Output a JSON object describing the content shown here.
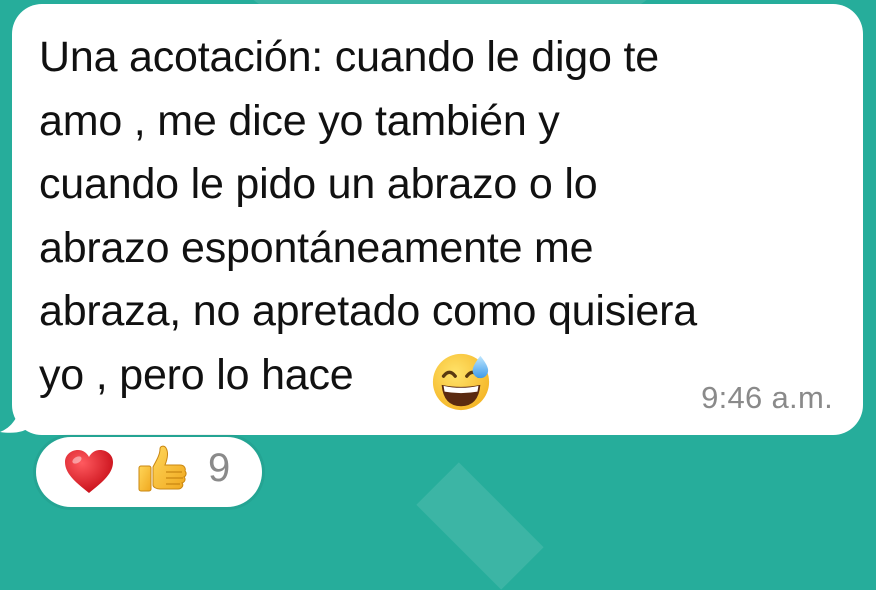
{
  "message": {
    "text_before_emoji": "Una acotación: cuando le digo te\namo , me dice yo también y\ncuando le pido un abrazo o lo\nabrazo espontáneamente me\nabraza, no apretado como quisiera\nyo , pero lo hace",
    "emoji": "sweat-smile-emoji",
    "timestamp": "9:46 a.m."
  },
  "reactions": {
    "items": [
      {
        "emoji": "heart-icon"
      },
      {
        "emoji": "thumbs-up-icon"
      }
    ],
    "count": "9"
  },
  "colors": {
    "background": "#26ad9b",
    "bubble": "#ffffff",
    "text": "#111111",
    "timestamp": "#8a8a8a",
    "heart": "#e0141e",
    "thumb": "#f8c33a"
  }
}
